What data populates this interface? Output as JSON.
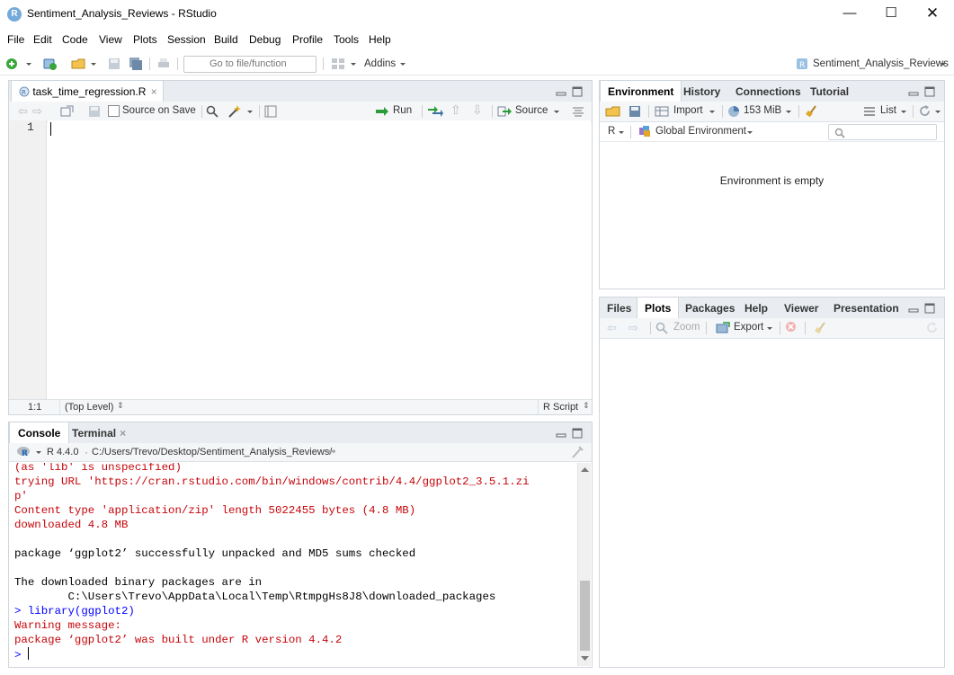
{
  "window": {
    "title": "Sentiment_Analysis_Reviews - RStudio"
  },
  "menu": [
    "File",
    "Edit",
    "Code",
    "View",
    "Plots",
    "Session",
    "Build",
    "Debug",
    "Profile",
    "Tools",
    "Help"
  ],
  "toolbar": {
    "goto_placeholder": "Go to file/function",
    "addins_label": "Addins",
    "project_label": "Sentiment_Analysis_Reviews"
  },
  "editor": {
    "tab_label": "task_time_regression.R",
    "source_on_save": "Source on Save",
    "run_label": "Run",
    "source_label": "Source",
    "line_number": "1",
    "status_position": "1:1",
    "status_scope": "(Top Level)",
    "status_filetype": "R Script"
  },
  "console": {
    "tabs": [
      "Console",
      "Terminal"
    ],
    "r_version": "R 4.4.0",
    "path": "C:/Users/Trevo/Desktop/Sentiment_Analysis_Reviews/",
    "lines": [
      {
        "text": "(as 'lib' is unspecified)",
        "color": "red"
      },
      {
        "text": "trying URL 'https://cran.rstudio.com/bin/windows/contrib/4.4/ggplot2_3.5.1.zi",
        "color": "red"
      },
      {
        "text": "p'",
        "color": "red"
      },
      {
        "text": "Content type 'application/zip' length 5022455 bytes (4.8 MB)",
        "color": "red"
      },
      {
        "text": "downloaded 4.8 MB",
        "color": "red"
      },
      {
        "text": "",
        "color": "black"
      },
      {
        "text": "package ‘ggplot2’ successfully unpacked and MD5 sums checked",
        "color": "black"
      },
      {
        "text": "",
        "color": "black"
      },
      {
        "text": "The downloaded binary packages are in",
        "color": "black"
      },
      {
        "text": "        C:\\Users\\Trevo\\AppData\\Local\\Temp\\RtmpgHs8J8\\downloaded_packages",
        "color": "black"
      },
      {
        "text": "> library(ggplot2)",
        "color": "blue"
      },
      {
        "text": "Warning message:",
        "color": "red"
      },
      {
        "text": "package ‘ggplot2’ was built under R version 4.4.2",
        "color": "red"
      }
    ],
    "prompt": ">"
  },
  "environment": {
    "tabs": [
      "Environment",
      "History",
      "Connections",
      "Tutorial"
    ],
    "import_label": "Import",
    "memory_label": "153 MiB",
    "list_label": "List",
    "language_label": "R",
    "scope_label": "Global Environment",
    "empty_message": "Environment is empty"
  },
  "files": {
    "tabs": [
      "Files",
      "Plots",
      "Packages",
      "Help",
      "Viewer",
      "Presentation"
    ],
    "zoom_label": "Zoom",
    "export_label": "Export"
  },
  "colors": {
    "accent": "#75aadb",
    "console_red": "#c5060b",
    "console_blue": "#0000ff"
  }
}
